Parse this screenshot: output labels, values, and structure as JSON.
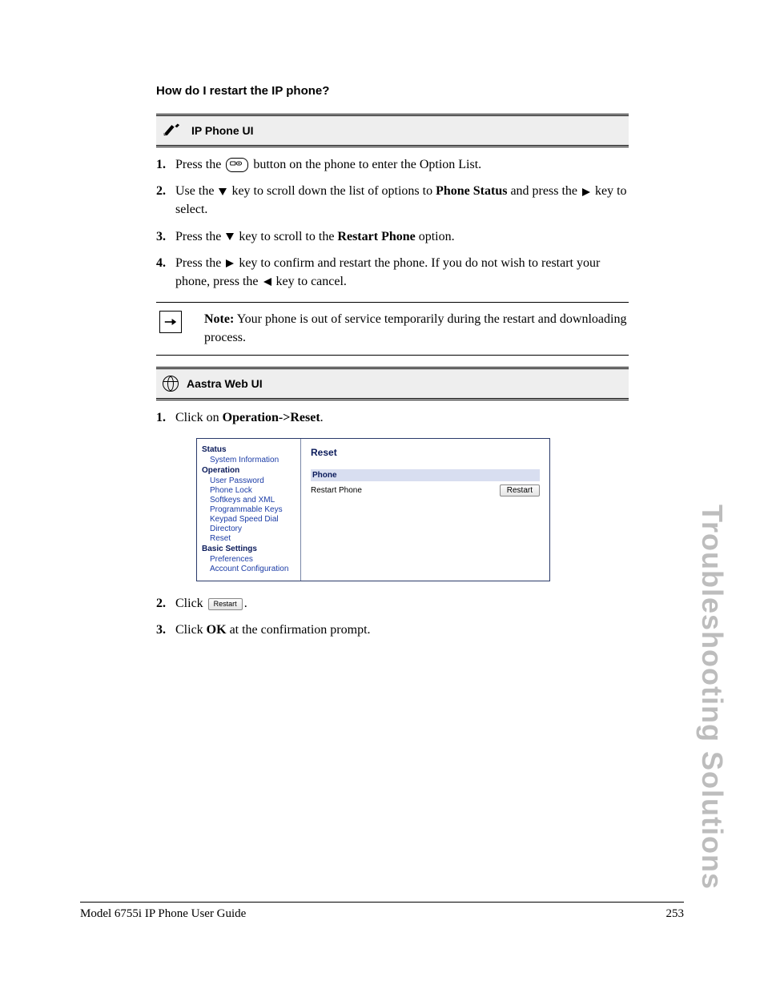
{
  "heading": "How do I restart the IP phone?",
  "bars": {
    "phone_ui": "IP Phone UI",
    "web_ui": "Aastra Web UI"
  },
  "phone_steps": {
    "s1_a": "Press the ",
    "s1_b": " button on the phone to enter the Option List.",
    "s2_a": "Use the ",
    "s2_b": " key to scroll down the list of options to ",
    "s2_bold": "Phone Status",
    "s2_c": " and press the ",
    "s2_d": " key to select.",
    "s3_a": "Press the ",
    "s3_b": " key to scroll to the ",
    "s3_bold": "Restart Phone",
    "s3_c": " option.",
    "s4_a": "Press the ",
    "s4_b": " key to confirm and restart the phone. If you do not wish to restart your phone, press the ",
    "s4_c": " key to cancel."
  },
  "note": {
    "label": "Note:",
    "text": " Your phone is out of service temporarily during the restart and downloading process."
  },
  "web_steps": {
    "s1_a": "Click on ",
    "s1_bold": "Operation->Reset",
    "s1_b": ".",
    "s2_a": "Click ",
    "s2_b": ".",
    "s3_a": "Click ",
    "s3_bold": "OK",
    "s3_b": " at the confirmation prompt."
  },
  "webui": {
    "nav": {
      "status": "Status",
      "status_items": [
        "System Information"
      ],
      "operation": "Operation",
      "operation_items": [
        "User Password",
        "Phone Lock",
        "Softkeys and XML",
        "Programmable Keys",
        "Keypad Speed Dial",
        "Directory",
        "Reset"
      ],
      "basic": "Basic Settings",
      "basic_items": [
        "Preferences",
        "Account Configuration"
      ]
    },
    "main": {
      "title": "Reset",
      "sub": "Phone",
      "row_label": "Restart Phone",
      "button": "Restart"
    }
  },
  "inline_button": "Restart",
  "footer": {
    "left": "Model 6755i IP Phone User Guide",
    "right": "253"
  },
  "side_label": "Troubleshooting Solutions"
}
